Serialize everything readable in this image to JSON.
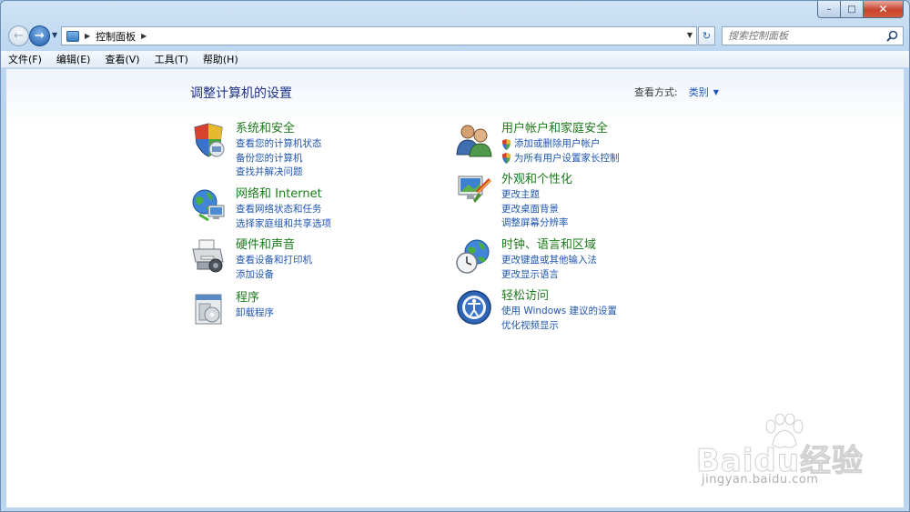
{
  "window": {
    "caption": {
      "minimize": "–",
      "maximize": "□",
      "close": "✕"
    }
  },
  "navigation": {
    "back": "←",
    "forward": "→",
    "breadcrumb": [
      "控制面板"
    ],
    "refresh": "↻",
    "search_placeholder": "搜索控制面板"
  },
  "menubar": {
    "items": [
      {
        "label": "文件(F)"
      },
      {
        "label": "编辑(E)"
      },
      {
        "label": "查看(V)"
      },
      {
        "label": "工具(T)"
      },
      {
        "label": "帮助(H)"
      }
    ]
  },
  "main": {
    "title": "调整计算机的设置",
    "view_by_label": "查看方式:",
    "view_by_value": "类别"
  },
  "categories": {
    "left": [
      {
        "title": "系统和安全",
        "icon": "system-security-icon",
        "links": [
          "查看您的计算机状态",
          "备份您的计算机",
          "查找并解决问题"
        ]
      },
      {
        "title": "网络和 Internet",
        "icon": "network-internet-icon",
        "links": [
          "查看网络状态和任务",
          "选择家庭组和共享选项"
        ]
      },
      {
        "title": "硬件和声音",
        "icon": "hardware-sound-icon",
        "links": [
          "查看设备和打印机",
          "添加设备"
        ]
      },
      {
        "title": "程序",
        "icon": "programs-icon",
        "links": [
          "卸载程序"
        ]
      }
    ],
    "right": [
      {
        "title": "用户帐户和家庭安全",
        "icon": "user-accounts-icon",
        "links": [
          "添加或删除用户帐户",
          "为所有用户设置家长控制"
        ],
        "shield_links": true
      },
      {
        "title": "外观和个性化",
        "icon": "appearance-icon",
        "links": [
          "更改主题",
          "更改桌面背景",
          "调整屏幕分辨率"
        ]
      },
      {
        "title": "时钟、语言和区域",
        "icon": "clock-region-icon",
        "links": [
          "更改键盘或其他输入法",
          "更改显示语言"
        ]
      },
      {
        "title": "轻松访问",
        "icon": "ease-of-access-icon",
        "links": [
          "使用 Windows 建议的设置",
          "优化视频显示"
        ]
      }
    ]
  },
  "watermark": {
    "logo": "Baidu经验",
    "url": "jingyan.baidu.com"
  },
  "colors": {
    "category_title": "#1b7a1b",
    "link": "#1f55b0",
    "page_title": "#1e3287"
  }
}
